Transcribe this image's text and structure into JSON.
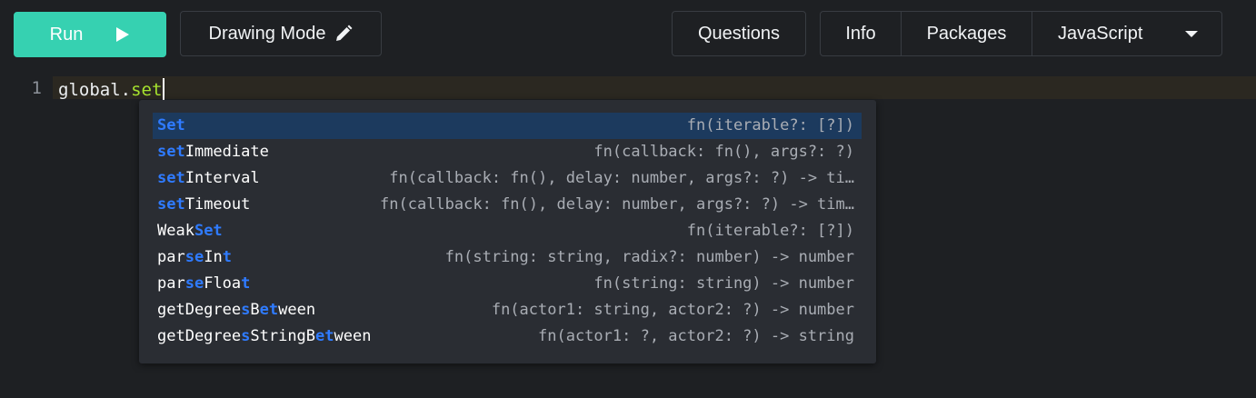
{
  "toolbar": {
    "run_label": "Run",
    "drawing_mode_label": "Drawing Mode",
    "questions_label": "Questions",
    "info_label": "Info",
    "packages_label": "Packages",
    "language_label": "JavaScript",
    "run_color": "#36d1b1"
  },
  "editor": {
    "line_number": "1",
    "code_object": "global",
    "code_dot": ".",
    "code_property": "set"
  },
  "autocomplete": {
    "items": [
      {
        "parts": [
          {
            "t": "Set",
            "m": true
          }
        ],
        "signature": "fn(iterable?: [?])",
        "selected": true
      },
      {
        "parts": [
          {
            "t": "set",
            "m": true
          },
          {
            "t": "Immediate",
            "m": false
          }
        ],
        "signature": "fn(callback: fn(), args?: ?)"
      },
      {
        "parts": [
          {
            "t": "set",
            "m": true
          },
          {
            "t": "Interval",
            "m": false
          }
        ],
        "signature": "fn(callback: fn(), delay: number, args?: ?) -> ti…"
      },
      {
        "parts": [
          {
            "t": "set",
            "m": true
          },
          {
            "t": "Timeout",
            "m": false
          }
        ],
        "signature": "fn(callback: fn(), delay: number, args?: ?) -> tim…"
      },
      {
        "parts": [
          {
            "t": "Weak",
            "m": false
          },
          {
            "t": "Set",
            "m": true
          }
        ],
        "signature": "fn(iterable?: [?])"
      },
      {
        "parts": [
          {
            "t": "par",
            "m": false
          },
          {
            "t": "se",
            "m": true
          },
          {
            "t": "In",
            "m": false
          },
          {
            "t": "t",
            "m": true
          }
        ],
        "signature": "fn(string: string, radix?: number) -> number"
      },
      {
        "parts": [
          {
            "t": "par",
            "m": false
          },
          {
            "t": "se",
            "m": true
          },
          {
            "t": "Floa",
            "m": false
          },
          {
            "t": "t",
            "m": true
          }
        ],
        "signature": "fn(string: string) -> number"
      },
      {
        "parts": [
          {
            "t": "getDegree",
            "m": false
          },
          {
            "t": "s",
            "m": true
          },
          {
            "t": "B",
            "m": false
          },
          {
            "t": "et",
            "m": true
          },
          {
            "t": "ween",
            "m": false
          }
        ],
        "signature": "fn(actor1: string, actor2: ?) -> number"
      },
      {
        "parts": [
          {
            "t": "getDegree",
            "m": false
          },
          {
            "t": "s",
            "m": true
          },
          {
            "t": "StringB",
            "m": false
          },
          {
            "t": "et",
            "m": true
          },
          {
            "t": "ween",
            "m": false
          }
        ],
        "signature": "fn(actor1: ?, actor2: ?) -> string"
      }
    ]
  }
}
